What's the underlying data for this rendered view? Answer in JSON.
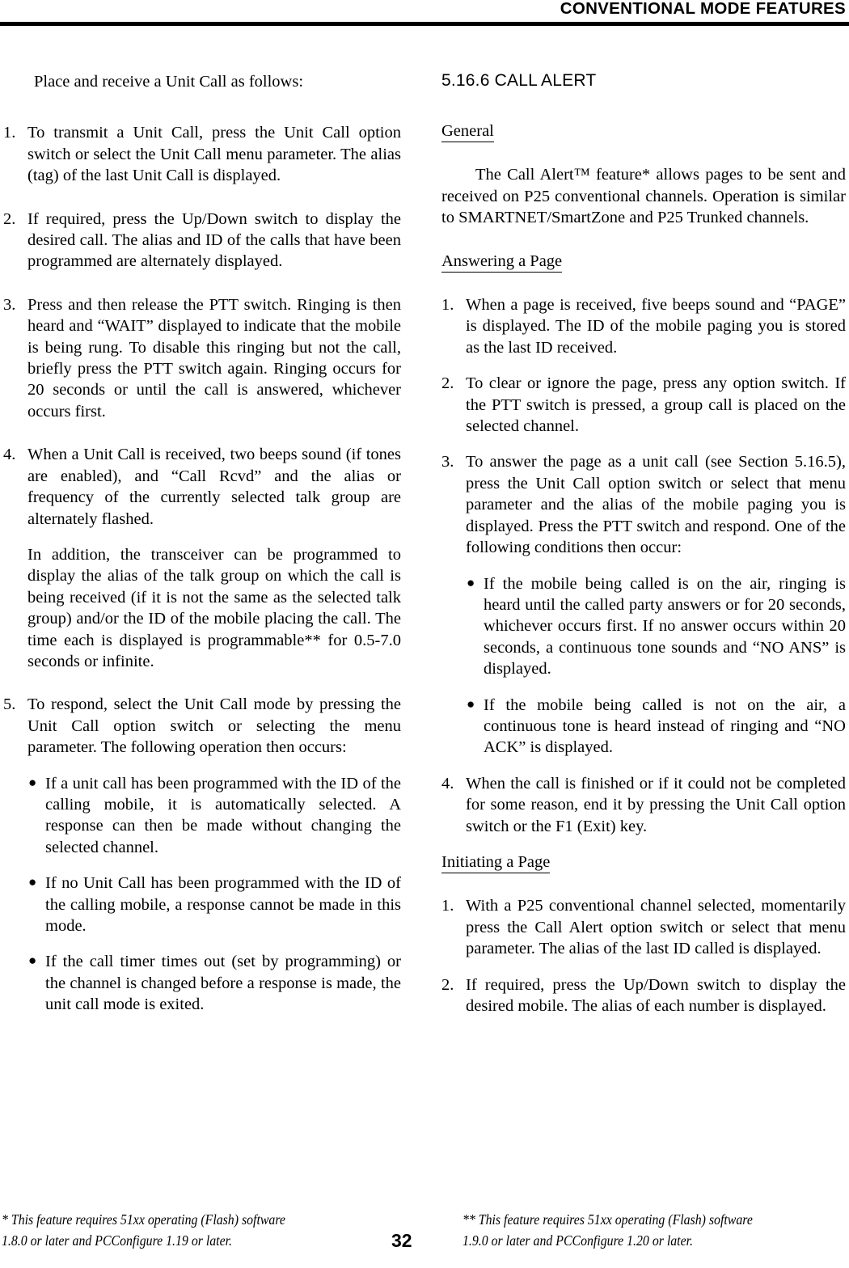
{
  "header": {
    "title": "CONVENTIONAL MODE FEATURES"
  },
  "left_column": {
    "intro": "Place and receive a Unit Call as follows:",
    "items": [
      {
        "num": "1.",
        "text": "To transmit a Unit Call, press the Unit Call option switch or select the Unit Call menu parameter. The alias (tag) of the last Unit Call is displayed."
      },
      {
        "num": "2.",
        "text": "If required, press the Up/Down switch to display the desired call. The alias and ID of the calls that have been programmed are alternately displayed."
      },
      {
        "num": "3.",
        "text": "Press and then release the PTT switch. Ringing is then heard and “WAIT” displayed to indicate that the mobile is being rung. To disable this ringing but not the call, briefly press the PTT switch again. Ringing occurs for 20 seconds or until the call is answered, whichever occurs first."
      },
      {
        "num": "4.",
        "text": "When a Unit Call is received, two beeps sound (if tones are enabled), and “Call Rcvd” and the alias or frequency of the currently selected talk group are alternately flashed."
      }
    ],
    "item4_continuation": "In addition, the transceiver can be programmed to display the alias of the talk group on which the call is being received (if it is not the same as the selected talk group) and/or the ID of the mobile placing the call. The time each is displayed is programmable** for 0.5-7.0 seconds or infinite.",
    "item5": {
      "num": "5.",
      "text": "To respond, select the Unit Call mode by pressing the Unit Call option switch or selecting the menu parameter. The following operation then occurs:"
    },
    "item5_bullets": [
      "If a unit call has been programmed with the ID of the calling mobile, it is automatically selected. A response can then be made without changing the selected channel.",
      "If no Unit Call has been programmed with the ID of the calling mobile, a response cannot be made in this mode.",
      "If the call timer times out (set by programming) or the channel is changed before a response is made, the unit call mode is exited."
    ]
  },
  "right_column": {
    "section_heading": "5.16.6  CALL ALERT",
    "general_heading": "General",
    "general_text": "The Call Alert™ feature* allows pages to be sent and received on P25 conventional channels. Operation is similar to SMARTNET/SmartZone and P25 Trunked channels.",
    "answering_heading": "Answering a Page",
    "answering_items": [
      {
        "num": "1.",
        "text": "When a page is received, five beeps sound and “PAGE” is displayed. The ID of the mobile paging you is stored as the last ID received."
      },
      {
        "num": "2.",
        "text": "To clear or ignore the page, press any option switch. If the PTT switch is pressed, a group call is placed on the selected channel."
      },
      {
        "num": "3.",
        "text": "To answer the page as a unit call (see Section 5.16.5), press the Unit Call option switch or select that menu parameter and the alias of the mobile paging you is displayed. Press the PTT switch and respond. One of the following conditions then occur:"
      }
    ],
    "answering_item3_bullets": [
      "If the mobile being called is on the air, ringing is heard until the called party answers or for 20 seconds, whichever occurs first. If no answer occurs within 20 seconds, a continuous tone sounds and “NO ANS” is displayed.",
      "If the mobile being called is not on the air, a continuous tone is heard instead of ringing and “NO ACK” is displayed."
    ],
    "answering_item4": {
      "num": "4.",
      "text": "When the call is finished or if it could not be completed for some reason, end it by pressing the Unit Call option switch or the F1 (Exit) key."
    },
    "initiating_heading": "Initiating a Page",
    "initiating_items": [
      {
        "num": "1.",
        "text": "With a P25 conventional channel selected, momentarily press the Call Alert option switch or select that menu parameter. The alias of the last ID called is displayed."
      },
      {
        "num": "2.",
        "text": "If required, press the Up/Down switch to display the desired mobile. The alias of each number is displayed."
      }
    ]
  },
  "footer": {
    "footnote_left_line1": "* This feature requires 51xx operating (Flash) software",
    "footnote_left_line2": "1.8.0 or later and PCConfigure 1.19 or later.",
    "footnote_right_line1": "** This feature requires 51xx operating (Flash) software",
    "footnote_right_line2": "1.9.0 or later and PCConfigure 1.20 or later.",
    "page_number": "32"
  }
}
